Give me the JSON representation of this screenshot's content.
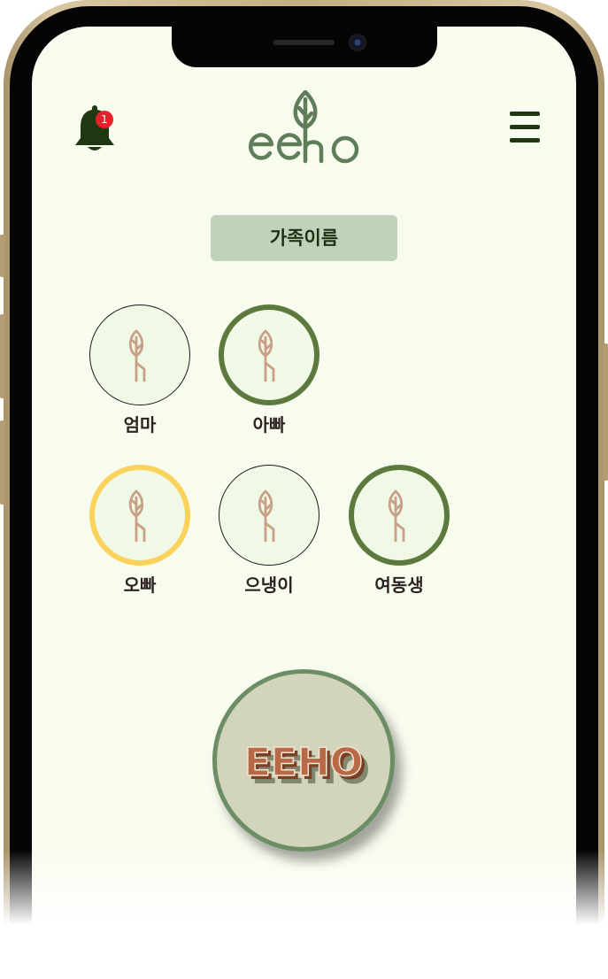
{
  "header": {
    "notification_count": "1",
    "logo_text": "eeho"
  },
  "family": {
    "title": "가족이름",
    "members": [
      {
        "name": "엄마",
        "ring": "thin"
      },
      {
        "name": "아빠",
        "ring": "green"
      },
      {
        "name": "오빠",
        "ring": "yellow"
      },
      {
        "name": "으냉이",
        "ring": "thin"
      },
      {
        "name": "여동생",
        "ring": "green"
      }
    ]
  },
  "action": {
    "button_text": "EEHO"
  },
  "colors": {
    "screen_bg": "#f8fcef",
    "dark_green": "#1f3812",
    "logo_green": "#5f7d5a",
    "ring_green": "#5d7a3e",
    "ring_yellow": "#fad25c",
    "sprout_tan": "#c8a088",
    "label_pill": "#bed3b9",
    "eeho_text": "#b86a46",
    "notification_red": "#e8202a"
  },
  "icons": [
    "bell-icon",
    "eeho-logo",
    "hamburger-menu-icon",
    "sprout-icon"
  ]
}
